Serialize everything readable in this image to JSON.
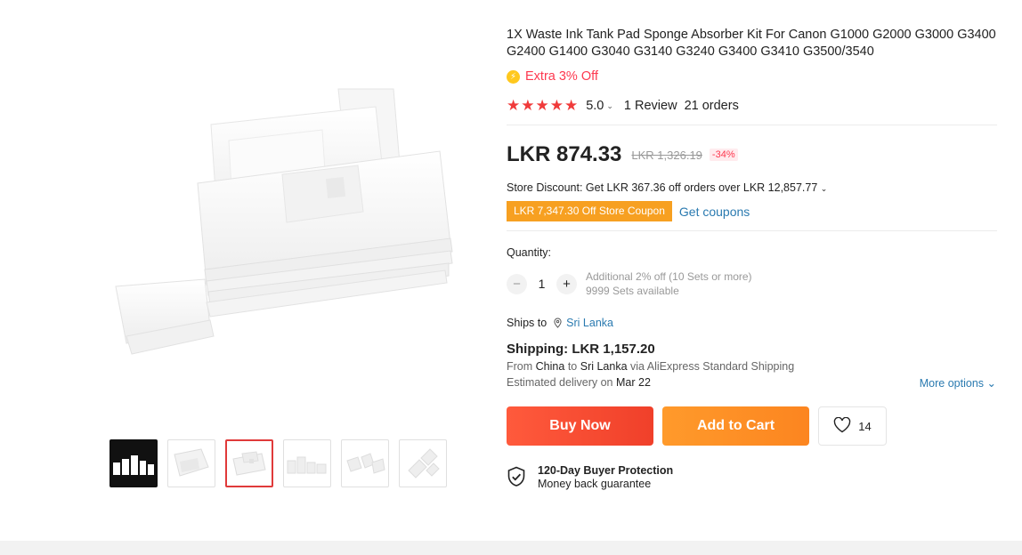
{
  "product": {
    "title": "1X Waste Ink Tank Pad Sponge Absorber Kit For Canon G1000 G2000 G3000 G3400 G2400 G1400 G3040 G3140 G3240 G3400 G3410 G3500/3540",
    "extra_off": "Extra 3% Off",
    "stars": "★★★★★",
    "rating": "5.0",
    "reviews": "1 Review",
    "orders": "21 orders"
  },
  "price": {
    "current": "LKR 874.33",
    "original": "LKR 1,326.19",
    "discount": "-34%"
  },
  "store": {
    "discount_text": "Store Discount: Get LKR 367.36 off orders over LKR 12,857.77",
    "coupon_label": "LKR 7,347.30 Off Store Coupon",
    "get_coupons": "Get coupons"
  },
  "quantity": {
    "label": "Quantity:",
    "value": "1",
    "note": "Additional 2% off (10 Sets or more)",
    "available": "9999 Sets available"
  },
  "shipping": {
    "ships_to_label": "Ships to",
    "country": "Sri Lanka",
    "price": "Shipping: LKR 1,157.20",
    "route_from_label": "From",
    "from": "China",
    "to_label": "to",
    "to": "Sri Lanka",
    "via": "via AliExpress Standard Shipping",
    "delivery_label": "Estimated delivery on",
    "delivery_date": "Mar 22",
    "more_options": "More options"
  },
  "actions": {
    "buy_now": "Buy Now",
    "add_to_cart": "Add to Cart",
    "wishlist_count": "14"
  },
  "protection": {
    "title": "120-Day Buyer Protection",
    "subtitle": "Money back guarantee"
  },
  "colors": {
    "accent_red": "#f0402a",
    "accent_orange": "#fc8520",
    "link_blue": "#2a7ab0",
    "coupon_bg": "#f7a021"
  }
}
